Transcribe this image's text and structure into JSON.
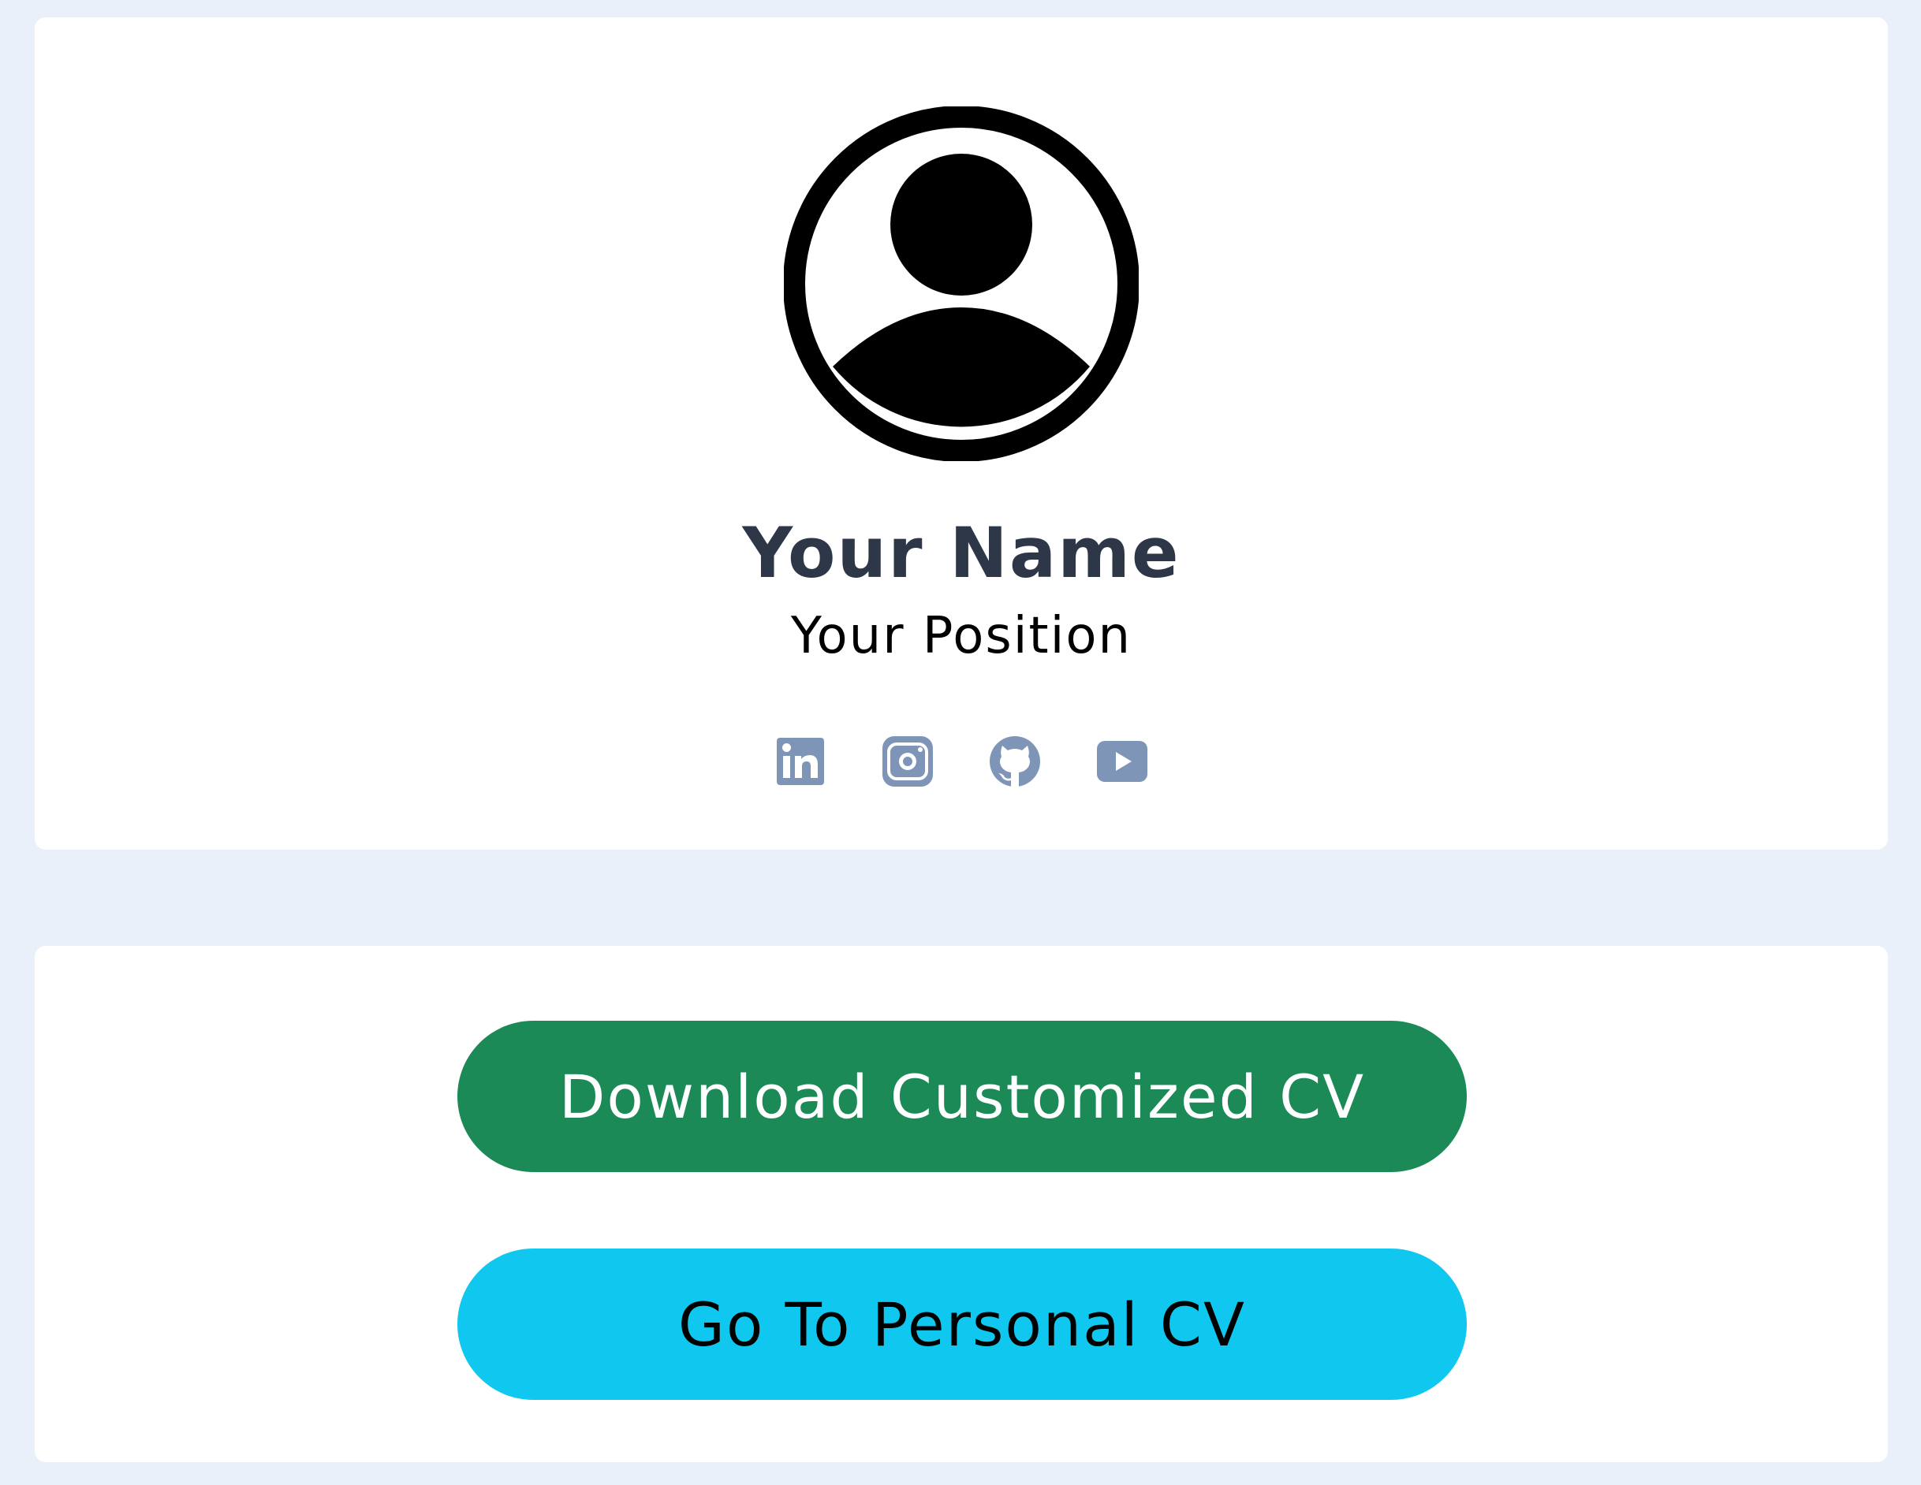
{
  "profile": {
    "name": "Your Name",
    "position": "Your Position",
    "socials": [
      {
        "icon": "linkedin-icon"
      },
      {
        "icon": "instagram-icon"
      },
      {
        "icon": "github-icon"
      },
      {
        "icon": "youtube-icon"
      }
    ]
  },
  "actions": {
    "download_label": "Download Customized CV",
    "personal_label": "Go To Personal CV"
  },
  "colors": {
    "page_background": "#eaf0f9",
    "card_background": "#ffffff",
    "name_text": "#2d3748",
    "social_icon": "#7f95b7",
    "download_button": "#1b8a57",
    "personal_button": "#10c8ef"
  }
}
